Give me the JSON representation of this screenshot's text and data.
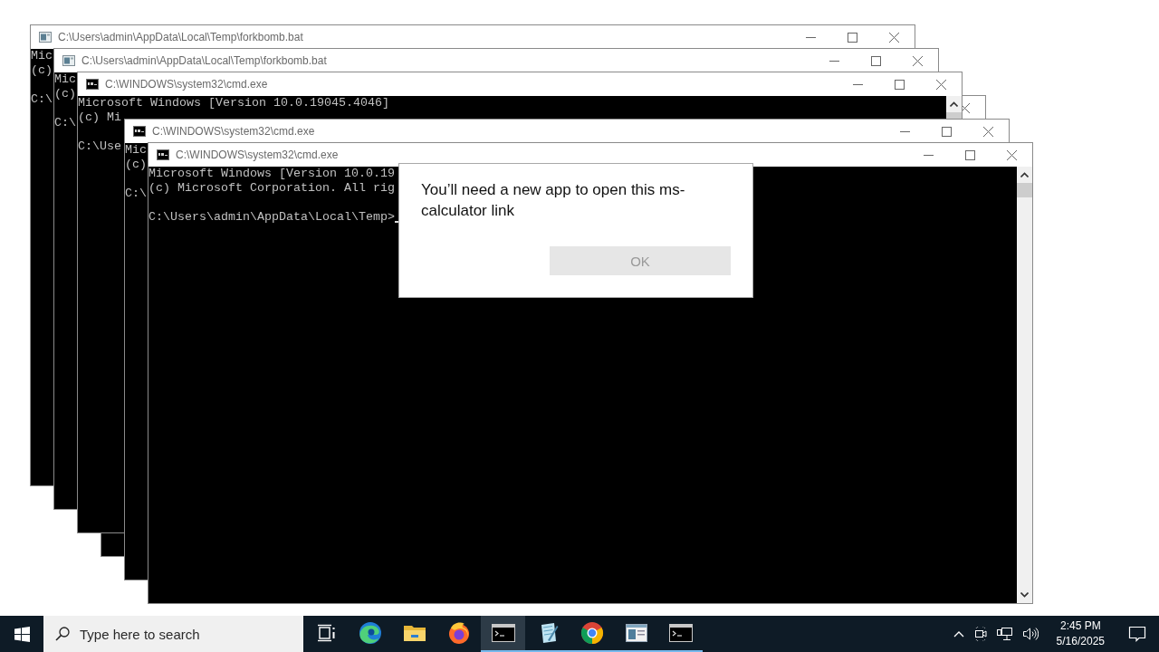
{
  "windows": [
    {
      "kind": "batch",
      "title": "C:\\Users\\admin\\AppData\\Local\\Temp\\forkbomb.bat",
      "blocks": [
        [
          "Mic",
          "(c)"
        ],
        [
          "C:\\"
        ]
      ]
    },
    {
      "kind": "batch",
      "title": "C:\\Users\\admin\\AppData\\Local\\Temp\\forkbomb.bat",
      "blocks": [
        [
          "Mic",
          "(c)"
        ],
        [
          "C:\\"
        ]
      ]
    },
    {
      "kind": "cmd",
      "title": "C:\\WINDOWS\\system32\\cmd.exe",
      "blocks": [
        [
          "Microsoft Windows [Version 10.0.19045.4046]",
          "(c) Mi"
        ],
        [
          "C:\\Use"
        ]
      ]
    },
    {
      "kind": "covered"
    },
    {
      "kind": "cmd",
      "title": "C:\\WINDOWS\\system32\\cmd.exe",
      "blocks": [
        [
          "Mic",
          "(c)"
        ],
        [
          "C:\\"
        ]
      ]
    },
    {
      "kind": "cmd",
      "title": "C:\\WINDOWS\\system32\\cmd.exe",
      "cursor": true,
      "blocks": [
        [
          "Microsoft Windows [Version 10.0.19",
          "(c) Microsoft Corporation. All rig"
        ],
        [
          "C:\\Users\\admin\\AppData\\Local\\Temp>"
        ]
      ]
    }
  ],
  "dialog": {
    "message": "You’ll need a new app to open this ms-calculator link",
    "button": {
      "label": "OK",
      "disabled": true
    }
  },
  "taskbar": {
    "search": {
      "placeholder": "Type here to search"
    },
    "apps": [
      {
        "kind": "taskview",
        "running": false,
        "selected": false
      },
      {
        "kind": "edge",
        "running": false,
        "selected": false
      },
      {
        "kind": "explorer",
        "running": false,
        "selected": false
      },
      {
        "kind": "firefox",
        "running": false,
        "selected": false
      },
      {
        "kind": "cmd",
        "running": true,
        "selected": true
      },
      {
        "kind": "notepad",
        "running": true,
        "selected": false
      },
      {
        "kind": "chrome",
        "running": true,
        "selected": false
      },
      {
        "kind": "window",
        "running": true,
        "selected": false
      },
      {
        "kind": "cmd",
        "running": true,
        "selected": false
      }
    ],
    "time": "2:45 PM",
    "date": "5/16/2025"
  }
}
